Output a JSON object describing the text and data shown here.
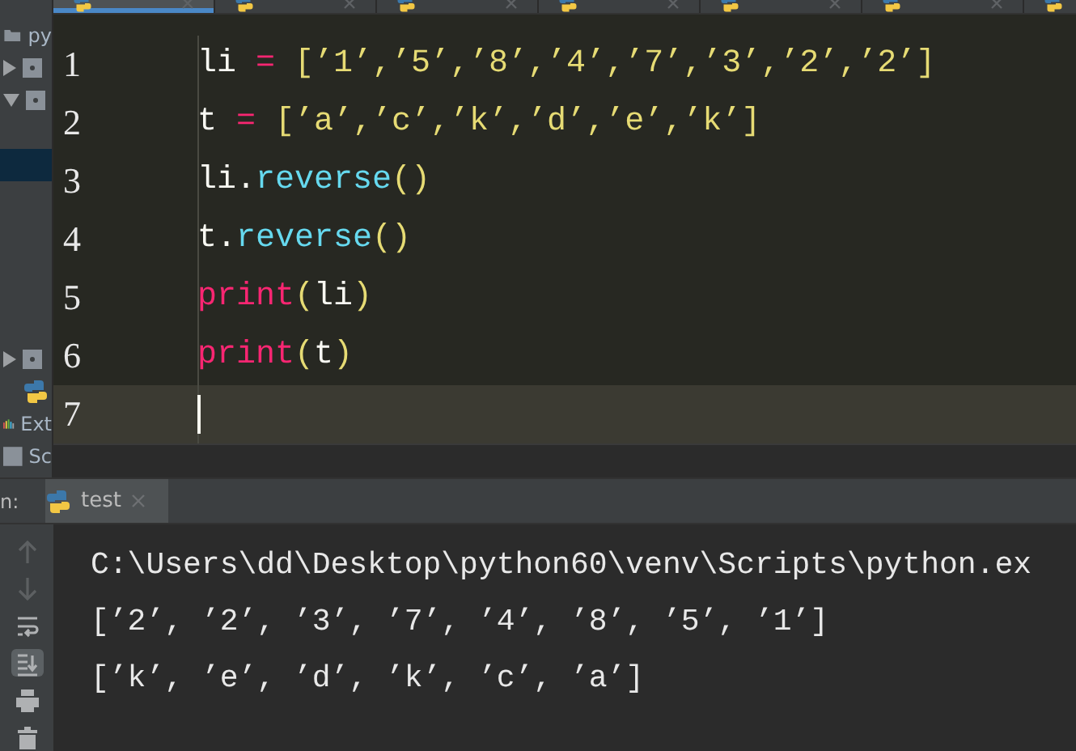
{
  "editor_tabs": [
    {
      "selected": true
    },
    {
      "selected": false
    },
    {
      "selected": false
    },
    {
      "selected": false
    },
    {
      "selected": false
    },
    {
      "selected": false
    },
    {
      "selected": false
    }
  ],
  "project_sidebar": {
    "items": [
      {
        "kind": "folder",
        "label": "py"
      },
      {
        "kind": "collapsed"
      },
      {
        "kind": "expanded"
      },
      {
        "kind": "blank"
      },
      {
        "kind": "selected"
      },
      {
        "kind": "blank"
      },
      {
        "kind": "blank"
      },
      {
        "kind": "blank"
      },
      {
        "kind": "blank"
      },
      {
        "kind": "blank"
      },
      {
        "kind": "collapsed"
      },
      {
        "kind": "pyfile"
      },
      {
        "kind": "libs",
        "label": "Ext"
      },
      {
        "kind": "scratch",
        "label": "Sc"
      }
    ]
  },
  "code_lines": [
    {
      "number": "1",
      "current": false,
      "tokens": [
        {
          "kind": "plain",
          "text": "li "
        },
        {
          "kind": "op",
          "text": "="
        },
        {
          "kind": "str",
          "text": " [’1’,’5’,’8’,’4’,’7’,’3’,’2’,’2’]"
        }
      ]
    },
    {
      "number": "2",
      "current": false,
      "tokens": [
        {
          "kind": "plain",
          "text": "t "
        },
        {
          "kind": "op",
          "text": "="
        },
        {
          "kind": "str",
          "text": " [’a’,’c’,’k’,’d’,’e’,’k’]"
        }
      ]
    },
    {
      "number": "3",
      "current": false,
      "tokens": [
        {
          "kind": "plain",
          "text": "li."
        },
        {
          "kind": "func",
          "text": "reverse"
        },
        {
          "kind": "str",
          "text": "()"
        }
      ]
    },
    {
      "number": "4",
      "current": false,
      "tokens": [
        {
          "kind": "plain",
          "text": "t."
        },
        {
          "kind": "func",
          "text": "reverse"
        },
        {
          "kind": "str",
          "text": "()"
        }
      ]
    },
    {
      "number": "5",
      "current": false,
      "tokens": [
        {
          "kind": "builtin",
          "text": "print"
        },
        {
          "kind": "str",
          "text": "("
        },
        {
          "kind": "plain",
          "text": "li"
        },
        {
          "kind": "str",
          "text": ")"
        }
      ]
    },
    {
      "number": "6",
      "current": false,
      "tokens": [
        {
          "kind": "builtin",
          "text": "print"
        },
        {
          "kind": "str",
          "text": "("
        },
        {
          "kind": "plain",
          "text": "t"
        },
        {
          "kind": "str",
          "text": ")"
        }
      ]
    },
    {
      "number": "7",
      "current": true
    }
  ],
  "run_panel": {
    "label": "n:",
    "tabs": [
      {
        "label": "test",
        "selected": true
      }
    ],
    "tools": [
      {
        "kind": "up",
        "disabled": true,
        "selected": false
      },
      {
        "kind": "down",
        "disabled": true,
        "selected": false
      },
      {
        "kind": "wrap",
        "disabled": false,
        "selected": false
      },
      {
        "kind": "scroll",
        "disabled": false,
        "selected": true
      },
      {
        "kind": "print",
        "disabled": false,
        "selected": false
      },
      {
        "kind": "trash",
        "disabled": false,
        "selected": false
      }
    ],
    "output": [
      "C:\\Users\\dd\\Desktop\\python60\\venv\\Scripts\\python.ex",
      "[’2’, ’2’, ’3’, ’7’, ’4’, ’8’, ’5’, ’1’]",
      "[’k’, ’e’, ’d’, ’k’, ’c’, ’a’]"
    ]
  }
}
